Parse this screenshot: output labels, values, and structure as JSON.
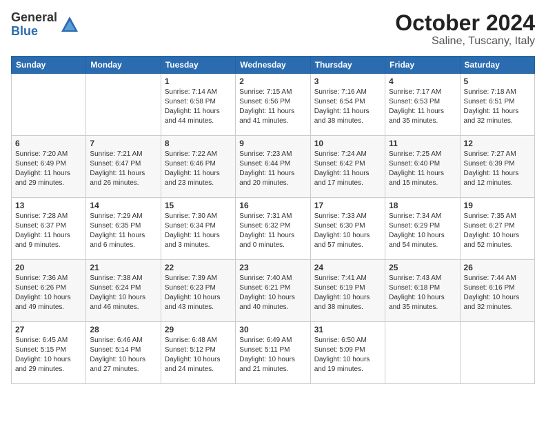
{
  "logo": {
    "general": "General",
    "blue": "Blue"
  },
  "header": {
    "month": "October 2024",
    "location": "Saline, Tuscany, Italy"
  },
  "weekdays": [
    "Sunday",
    "Monday",
    "Tuesday",
    "Wednesday",
    "Thursday",
    "Friday",
    "Saturday"
  ],
  "weeks": [
    [
      {
        "day": "",
        "info": ""
      },
      {
        "day": "",
        "info": ""
      },
      {
        "day": "1",
        "info": "Sunrise: 7:14 AM\nSunset: 6:58 PM\nDaylight: 11 hours and 44 minutes."
      },
      {
        "day": "2",
        "info": "Sunrise: 7:15 AM\nSunset: 6:56 PM\nDaylight: 11 hours and 41 minutes."
      },
      {
        "day": "3",
        "info": "Sunrise: 7:16 AM\nSunset: 6:54 PM\nDaylight: 11 hours and 38 minutes."
      },
      {
        "day": "4",
        "info": "Sunrise: 7:17 AM\nSunset: 6:53 PM\nDaylight: 11 hours and 35 minutes."
      },
      {
        "day": "5",
        "info": "Sunrise: 7:18 AM\nSunset: 6:51 PM\nDaylight: 11 hours and 32 minutes."
      }
    ],
    [
      {
        "day": "6",
        "info": "Sunrise: 7:20 AM\nSunset: 6:49 PM\nDaylight: 11 hours and 29 minutes."
      },
      {
        "day": "7",
        "info": "Sunrise: 7:21 AM\nSunset: 6:47 PM\nDaylight: 11 hours and 26 minutes."
      },
      {
        "day": "8",
        "info": "Sunrise: 7:22 AM\nSunset: 6:46 PM\nDaylight: 11 hours and 23 minutes."
      },
      {
        "day": "9",
        "info": "Sunrise: 7:23 AM\nSunset: 6:44 PM\nDaylight: 11 hours and 20 minutes."
      },
      {
        "day": "10",
        "info": "Sunrise: 7:24 AM\nSunset: 6:42 PM\nDaylight: 11 hours and 17 minutes."
      },
      {
        "day": "11",
        "info": "Sunrise: 7:25 AM\nSunset: 6:40 PM\nDaylight: 11 hours and 15 minutes."
      },
      {
        "day": "12",
        "info": "Sunrise: 7:27 AM\nSunset: 6:39 PM\nDaylight: 11 hours and 12 minutes."
      }
    ],
    [
      {
        "day": "13",
        "info": "Sunrise: 7:28 AM\nSunset: 6:37 PM\nDaylight: 11 hours and 9 minutes."
      },
      {
        "day": "14",
        "info": "Sunrise: 7:29 AM\nSunset: 6:35 PM\nDaylight: 11 hours and 6 minutes."
      },
      {
        "day": "15",
        "info": "Sunrise: 7:30 AM\nSunset: 6:34 PM\nDaylight: 11 hours and 3 minutes."
      },
      {
        "day": "16",
        "info": "Sunrise: 7:31 AM\nSunset: 6:32 PM\nDaylight: 11 hours and 0 minutes."
      },
      {
        "day": "17",
        "info": "Sunrise: 7:33 AM\nSunset: 6:30 PM\nDaylight: 10 hours and 57 minutes."
      },
      {
        "day": "18",
        "info": "Sunrise: 7:34 AM\nSunset: 6:29 PM\nDaylight: 10 hours and 54 minutes."
      },
      {
        "day": "19",
        "info": "Sunrise: 7:35 AM\nSunset: 6:27 PM\nDaylight: 10 hours and 52 minutes."
      }
    ],
    [
      {
        "day": "20",
        "info": "Sunrise: 7:36 AM\nSunset: 6:26 PM\nDaylight: 10 hours and 49 minutes."
      },
      {
        "day": "21",
        "info": "Sunrise: 7:38 AM\nSunset: 6:24 PM\nDaylight: 10 hours and 46 minutes."
      },
      {
        "day": "22",
        "info": "Sunrise: 7:39 AM\nSunset: 6:23 PM\nDaylight: 10 hours and 43 minutes."
      },
      {
        "day": "23",
        "info": "Sunrise: 7:40 AM\nSunset: 6:21 PM\nDaylight: 10 hours and 40 minutes."
      },
      {
        "day": "24",
        "info": "Sunrise: 7:41 AM\nSunset: 6:19 PM\nDaylight: 10 hours and 38 minutes."
      },
      {
        "day": "25",
        "info": "Sunrise: 7:43 AM\nSunset: 6:18 PM\nDaylight: 10 hours and 35 minutes."
      },
      {
        "day": "26",
        "info": "Sunrise: 7:44 AM\nSunset: 6:16 PM\nDaylight: 10 hours and 32 minutes."
      }
    ],
    [
      {
        "day": "27",
        "info": "Sunrise: 6:45 AM\nSunset: 5:15 PM\nDaylight: 10 hours and 29 minutes."
      },
      {
        "day": "28",
        "info": "Sunrise: 6:46 AM\nSunset: 5:14 PM\nDaylight: 10 hours and 27 minutes."
      },
      {
        "day": "29",
        "info": "Sunrise: 6:48 AM\nSunset: 5:12 PM\nDaylight: 10 hours and 24 minutes."
      },
      {
        "day": "30",
        "info": "Sunrise: 6:49 AM\nSunset: 5:11 PM\nDaylight: 10 hours and 21 minutes."
      },
      {
        "day": "31",
        "info": "Sunrise: 6:50 AM\nSunset: 5:09 PM\nDaylight: 10 hours and 19 minutes."
      },
      {
        "day": "",
        "info": ""
      },
      {
        "day": "",
        "info": ""
      }
    ]
  ]
}
